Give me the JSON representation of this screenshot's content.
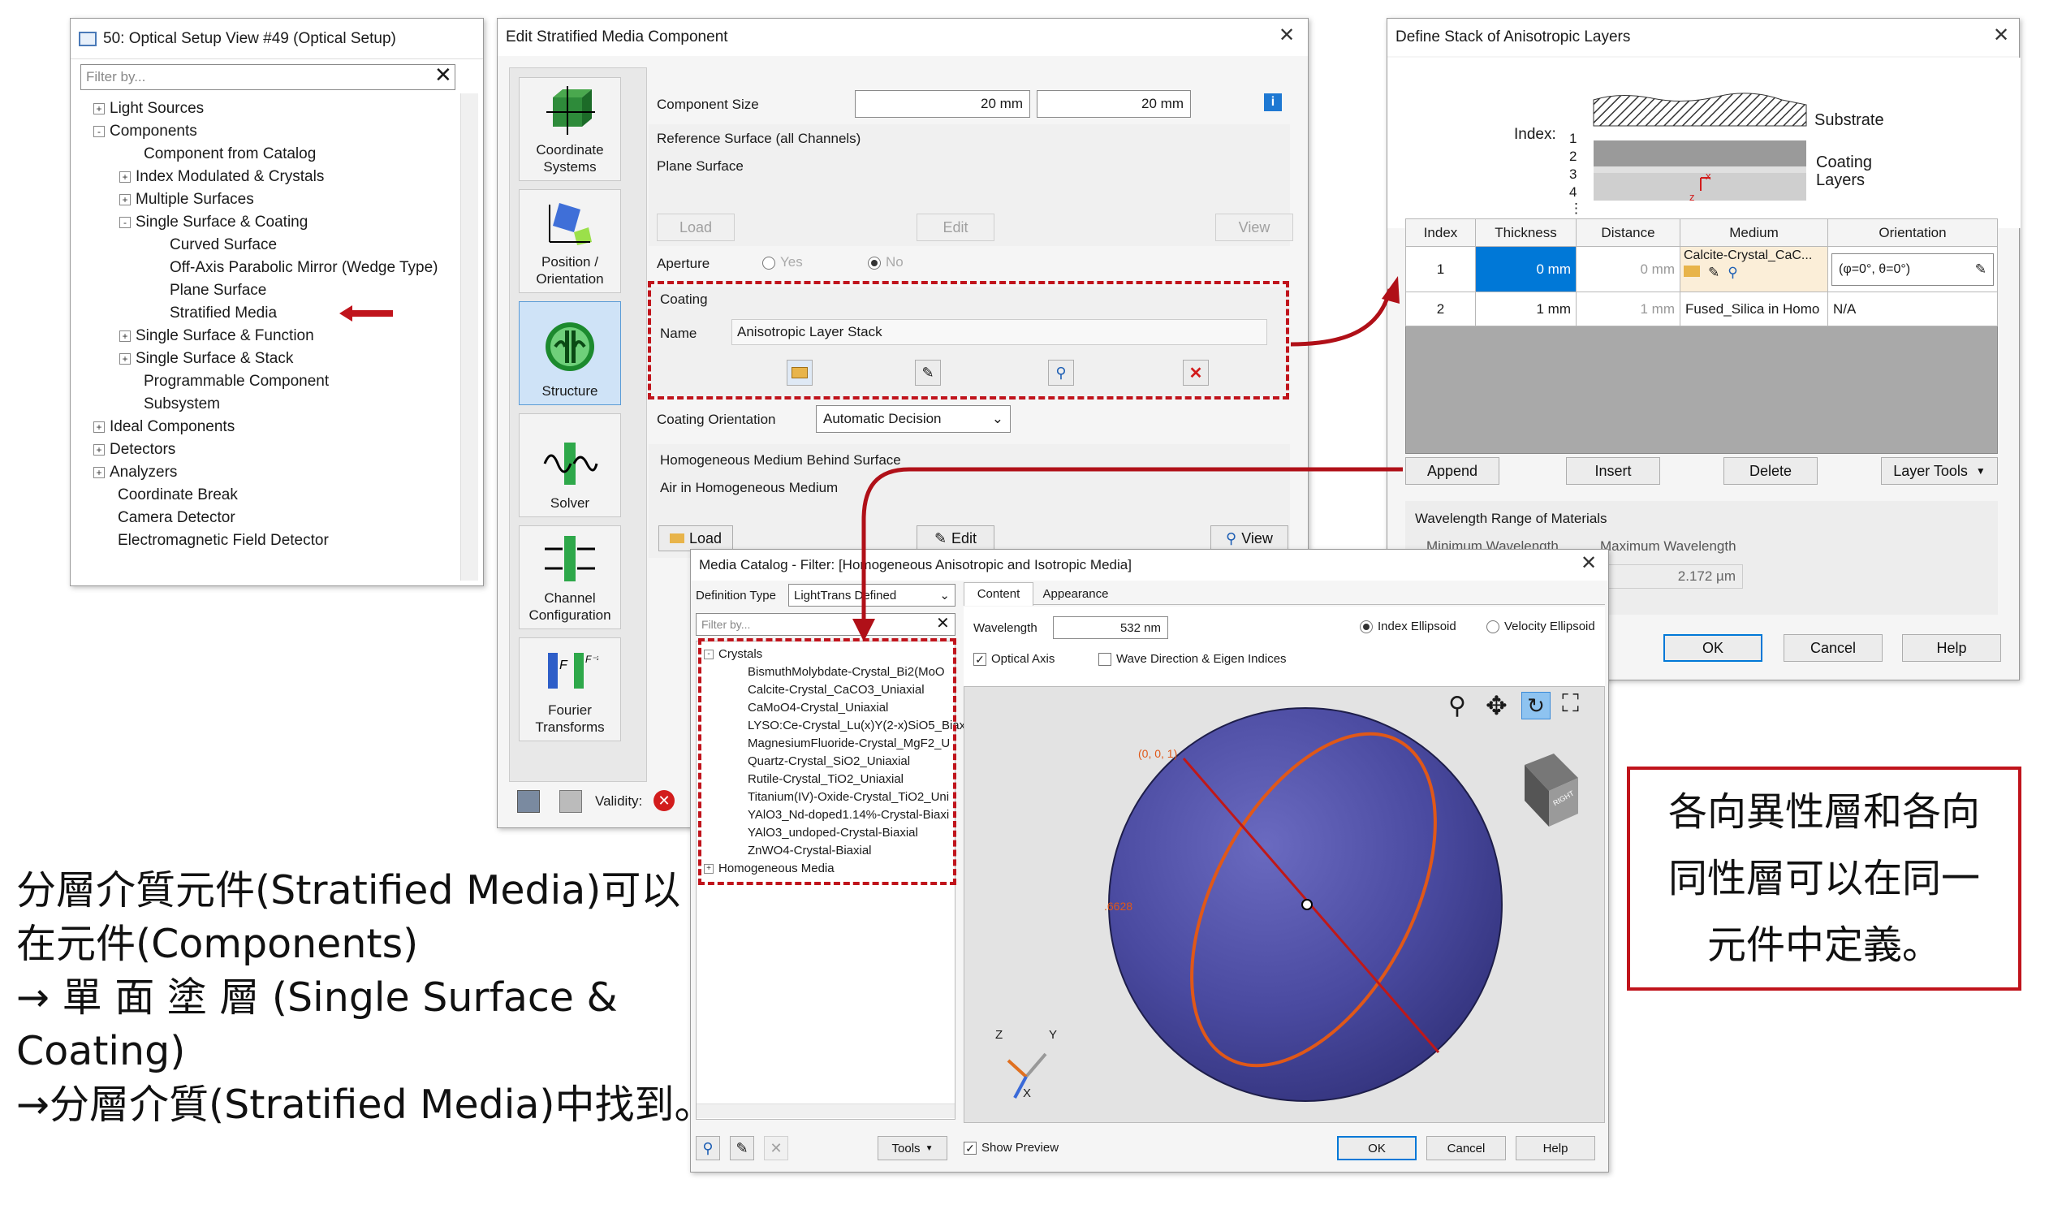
{
  "tree_window": {
    "title": "50: Optical Setup View #49 (Optical Setup)",
    "filter_placeholder": "Filter by...",
    "items": [
      {
        "label": "Light Sources",
        "toggle": "+"
      },
      {
        "label": "Components",
        "toggle": "-"
      },
      {
        "label": "Component from Catalog",
        "toggle": ""
      },
      {
        "label": "Index Modulated & Crystals",
        "toggle": "+"
      },
      {
        "label": "Multiple Surfaces",
        "toggle": "+"
      },
      {
        "label": "Single Surface & Coating",
        "toggle": "-"
      },
      {
        "label": "Curved Surface",
        "toggle": ""
      },
      {
        "label": "Off-Axis Parabolic Mirror (Wedge Type)",
        "toggle": ""
      },
      {
        "label": "Plane Surface",
        "toggle": ""
      },
      {
        "label": "Stratified Media",
        "toggle": ""
      },
      {
        "label": "Single Surface & Function",
        "toggle": "+"
      },
      {
        "label": "Single Surface & Stack",
        "toggle": "+"
      },
      {
        "label": "Programmable Component",
        "toggle": ""
      },
      {
        "label": "Subsystem",
        "toggle": ""
      },
      {
        "label": "Ideal Components",
        "toggle": "+"
      },
      {
        "label": "Detectors",
        "toggle": "+"
      },
      {
        "label": "Analyzers",
        "toggle": "+"
      },
      {
        "label": "Coordinate Break",
        "toggle": ""
      },
      {
        "label": "Camera Detector",
        "toggle": ""
      },
      {
        "label": "Electromagnetic Field Detector",
        "toggle": ""
      }
    ]
  },
  "edit_window": {
    "title": "Edit Stratified Media Component",
    "nav": [
      {
        "label": "Coordinate Systems"
      },
      {
        "label": "Position / Orientation"
      },
      {
        "label": "Structure"
      },
      {
        "label": "Solver"
      },
      {
        "label": "Channel Configuration"
      },
      {
        "label": "Fourier Transforms"
      }
    ],
    "component_size_label": "Component Size",
    "size_x": "20 mm",
    "size_times": "×",
    "size_y": "20 mm",
    "info_icon": "i",
    "reference_surface_label": "Reference Surface (all Channels)",
    "reference_surface_value": "Plane Surface",
    "ref_load": "Load",
    "ref_edit": "Edit",
    "ref_view": "View",
    "aperture_label": "Aperture",
    "aperture_yes": "Yes",
    "aperture_no": "No",
    "coating_label": "Coating",
    "coating_name_label": "Name",
    "coating_name_value": "Anisotropic Layer Stack",
    "coating_orientation_label": "Coating Orientation",
    "coating_orientation_value": "Automatic Decision",
    "medium_label": "Homogeneous Medium Behind Surface",
    "medium_value": "Air in Homogeneous Medium",
    "medium_load": "Load",
    "medium_edit": "Edit",
    "medium_view": "View",
    "validity_label": "Validity:"
  },
  "stack_window": {
    "title": "Define Stack of Anisotropic Layers",
    "diagram": {
      "index_label": "Index:",
      "indices": [
        "1",
        "2",
        "3",
        "4",
        "⋮"
      ],
      "substrate_label": "Substrate",
      "coating_label": "Coating",
      "layers_label": "Layers",
      "axis_z": "z",
      "axis_x": "x"
    },
    "columns": [
      "Index",
      "Thickness",
      "Distance",
      "Medium",
      "Orientation"
    ],
    "rows": [
      {
        "index": "1",
        "thickness": "0 mm",
        "distance": "0 mm",
        "medium": "Calcite-Crystal_CaC...",
        "orientation": "(φ=0°, θ=0°)"
      },
      {
        "index": "2",
        "thickness": "1 mm",
        "distance": "1 mm",
        "medium": "Fused_Silica in Homo",
        "orientation": "N/A"
      }
    ],
    "append": "Append",
    "insert": "Insert",
    "delete": "Delete",
    "layer_tools": "Layer Tools",
    "wavelength_range_label": "Wavelength Range of Materials",
    "min_wavelength_label": "Minimum Wavelength",
    "max_wavelength_label": "Maximum Wavelength",
    "max_wavelength_value": "2.172 µm",
    "ok": "OK",
    "cancel": "Cancel",
    "help": "Help"
  },
  "catalog_window": {
    "title": "Media Catalog - Filter: [Homogeneous Anisotropic and Isotropic Media]",
    "definition_type_label": "Definition Type",
    "definition_type_value": "LightTrans Defined",
    "filter_placeholder": "Filter by...",
    "tabs": [
      "Content",
      "Appearance"
    ],
    "wavelength_label": "Wavelength",
    "wavelength_value": "532 nm",
    "index_ellipsoid": "Index Ellipsoid",
    "velocity_ellipsoid": "Velocity Ellipsoid",
    "optical_axis": "Optical Axis",
    "wave_direction": "Wave Direction & Eigen Indices",
    "crystals_label": "Crystals",
    "crystals": [
      "BismuthMolybdate-Crystal_Bi2(MoO",
      "Calcite-Crystal_CaCO3_Uniaxial",
      "CaMoO4-Crystal_Uniaxial",
      "LYSO:Ce-Crystal_Lu(x)Y(2-x)SiO5_Biax",
      "MagnesiumFluoride-Crystal_MgF2_U",
      "Quartz-Crystal_SiO2_Uniaxial",
      "Rutile-Crystal_TiO2_Uniaxial",
      "Titanium(IV)-Oxide-Crystal_TiO2_Uni",
      "YAlO3_Nd-doped1.14%-Crystal-Biaxi",
      "YAlO3_undoped-Crystal-Biaxial",
      "ZnWO4-Crystal-Biaxial"
    ],
    "homogeneous_label": "Homogeneous Media",
    "preview_coord_label": "(0, 0, 1)",
    "preview_value_label": ".6628",
    "axis_z": "Z",
    "axis_y": "Y",
    "axis_x": "X",
    "cube_label": "RIGHT",
    "tools_label": "Tools",
    "show_preview": "Show Preview",
    "ok": "OK",
    "cancel": "Cancel",
    "help": "Help"
  },
  "annotation_left": {
    "line1": "分層介質元件(Stratified Media)可以",
    "line2": "在元件(Components)",
    "line3": "→ 單 面 塗 層 (Single Surface &",
    "line4": "Coating)",
    "line5": "→分層介質(Stratified Media)中找到。"
  },
  "annotation_right": {
    "line1": "各向異性層和各向",
    "line2": "同性層可以在同一",
    "line3": "元件中定義。"
  },
  "colors": {
    "highlight_red": "#c0141c",
    "selection_blue": "#0078d7",
    "sphere_purple": "#4a4aa0"
  }
}
